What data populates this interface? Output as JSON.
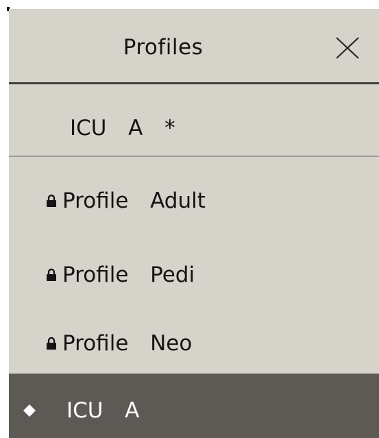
{
  "menu": {
    "title": "Profiles",
    "close_icon": "close-icon",
    "current_profile": "ICU  A  *",
    "items": [
      {
        "label": "Profile  Adult",
        "icon": "lock-icon",
        "selected": false
      },
      {
        "label": "Profile  Pedi",
        "icon": "lock-icon",
        "selected": false
      },
      {
        "label": "Profile  Neo",
        "icon": "lock-icon",
        "selected": false
      },
      {
        "label": "ICU  A",
        "icon": "diamond-icon",
        "selected": true
      }
    ]
  },
  "colors": {
    "panel_background": "#d6d3cb",
    "selected_background": "#5d5a55",
    "text": "#141414",
    "selected_text": "#ffffff"
  }
}
